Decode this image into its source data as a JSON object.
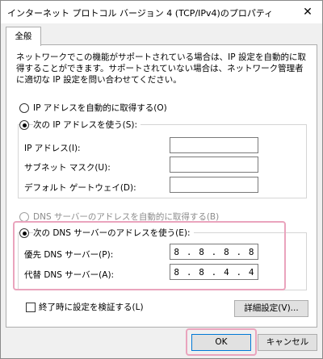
{
  "window": {
    "title": "インターネット プロトコル バージョン 4 (TCP/IPv4)のプロパティ",
    "close_symbol": "✕"
  },
  "tab": {
    "label": "全般"
  },
  "description": "ネットワークでこの機能がサポートされている場合は、IP 設定を自動的に取得することができます。サポートされていない場合は、ネットワーク管理者に適切な IP 設定を問い合わせてください。",
  "ip_section": {
    "auto_label": "IP アドレスを自動的に取得する(O)",
    "manual_label": "次の IP アドレスを使う(S):",
    "selected": "manual",
    "fields": [
      {
        "label": "IP アドレス(I):",
        "value": ""
      },
      {
        "label": "サブネット マスク(U):",
        "value": ""
      },
      {
        "label": "デフォルト ゲートウェイ(D):",
        "value": ""
      }
    ]
  },
  "dns_section": {
    "auto_label": "DNS サーバーのアドレスを自動的に取得する(B)",
    "manual_label": "次の DNS サーバーのアドレスを使う(E):",
    "selected": "manual",
    "preferred": {
      "label": "優先 DNS サーバー(P):",
      "octets": [
        "8",
        "8",
        "8",
        "8"
      ]
    },
    "alternate": {
      "label": "代替 DNS サーバー(A):",
      "octets": [
        "8",
        "8",
        "4",
        "4"
      ]
    }
  },
  "validate": {
    "label": "終了時に設定を検証する(L)",
    "checked": false
  },
  "buttons": {
    "advanced": "詳細設定(V)...",
    "ok": "OK",
    "cancel": "キャンセル"
  },
  "colors": {
    "highlight": "#eaa4bd",
    "focus_border": "#0078d7"
  }
}
